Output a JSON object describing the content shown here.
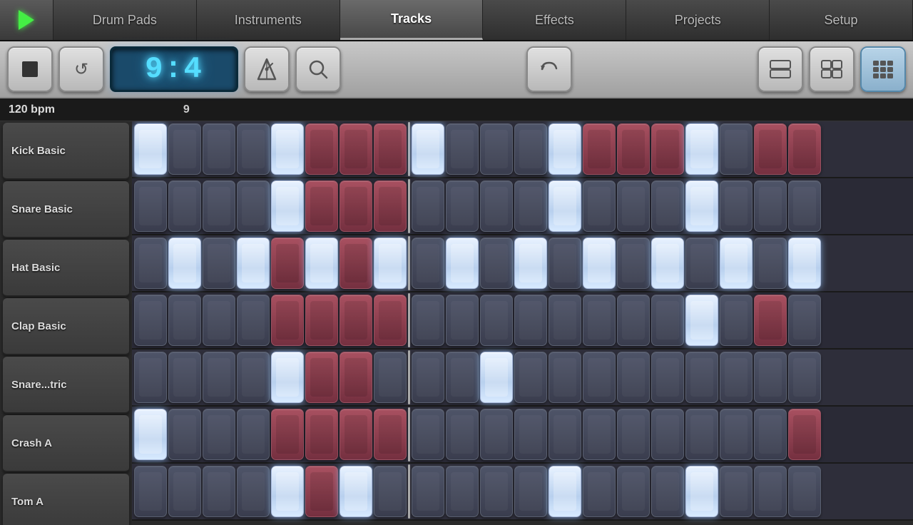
{
  "nav": {
    "tabs": [
      {
        "id": "drum-pads",
        "label": "Drum Pads",
        "active": false
      },
      {
        "id": "instruments",
        "label": "Instruments",
        "active": false
      },
      {
        "id": "tracks",
        "label": "Tracks",
        "active": true
      },
      {
        "id": "effects",
        "label": "Effects",
        "active": false
      },
      {
        "id": "projects",
        "label": "Projects",
        "active": false
      },
      {
        "id": "setup",
        "label": "Setup",
        "active": false
      }
    ]
  },
  "toolbar": {
    "stop_label": "■",
    "loop_label": "↺",
    "lcd_value": "9:4",
    "metronome_label": "🔔",
    "search_label": "🔍",
    "undo_label": "↩",
    "bpm": "120 bpm",
    "measure": "9"
  },
  "tracks": [
    {
      "id": "kick-basic",
      "label": "Kick Basic"
    },
    {
      "id": "snare-basic",
      "label": "Snare Basic"
    },
    {
      "id": "hat-basic",
      "label": "Hat Basic"
    },
    {
      "id": "clap-basic",
      "label": "Clap Basic"
    },
    {
      "id": "snare-tric",
      "label": "Snare...tric"
    },
    {
      "id": "crash-a",
      "label": "Crash A"
    },
    {
      "id": "tom-a",
      "label": "Tom A"
    }
  ],
  "grid": {
    "rows": [
      {
        "track": "kick-basic",
        "cells": [
          "white",
          "off",
          "off",
          "off",
          "white",
          "red",
          "red",
          "red",
          "white",
          "off",
          "off",
          "off",
          "white",
          "red",
          "red",
          "red",
          "white",
          "off",
          "red",
          "red"
        ]
      },
      {
        "track": "snare-basic",
        "cells": [
          "off",
          "off",
          "off",
          "off",
          "white",
          "red",
          "red",
          "red",
          "off",
          "off",
          "off",
          "off",
          "white",
          "off",
          "off",
          "off",
          "white",
          "off",
          "off",
          "off"
        ]
      },
      {
        "track": "hat-basic",
        "cells": [
          "off",
          "white",
          "off",
          "white",
          "red",
          "white",
          "red",
          "white",
          "off",
          "white",
          "off",
          "white",
          "off",
          "white",
          "off",
          "white",
          "off",
          "white",
          "off",
          "white"
        ]
      },
      {
        "track": "clap-basic",
        "cells": [
          "off",
          "off",
          "off",
          "off",
          "red",
          "red",
          "red",
          "red",
          "off",
          "off",
          "off",
          "off",
          "off",
          "off",
          "off",
          "off",
          "white",
          "off",
          "red",
          "off"
        ]
      },
      {
        "track": "snare-tric",
        "cells": [
          "off",
          "off",
          "off",
          "off",
          "white",
          "red",
          "red",
          "off",
          "off",
          "off",
          "white",
          "off",
          "off",
          "off",
          "off",
          "off",
          "off",
          "off",
          "off",
          "off"
        ]
      },
      {
        "track": "crash-a",
        "cells": [
          "white",
          "off",
          "off",
          "off",
          "red",
          "red",
          "red",
          "red",
          "off",
          "off",
          "off",
          "off",
          "off",
          "off",
          "off",
          "off",
          "off",
          "off",
          "off",
          "red"
        ]
      },
      {
        "track": "tom-a",
        "cells": [
          "off",
          "off",
          "off",
          "off",
          "white",
          "red",
          "white",
          "off",
          "off",
          "off",
          "off",
          "off",
          "white",
          "off",
          "off",
          "off",
          "off",
          "off",
          "off",
          "off"
        ]
      }
    ]
  }
}
